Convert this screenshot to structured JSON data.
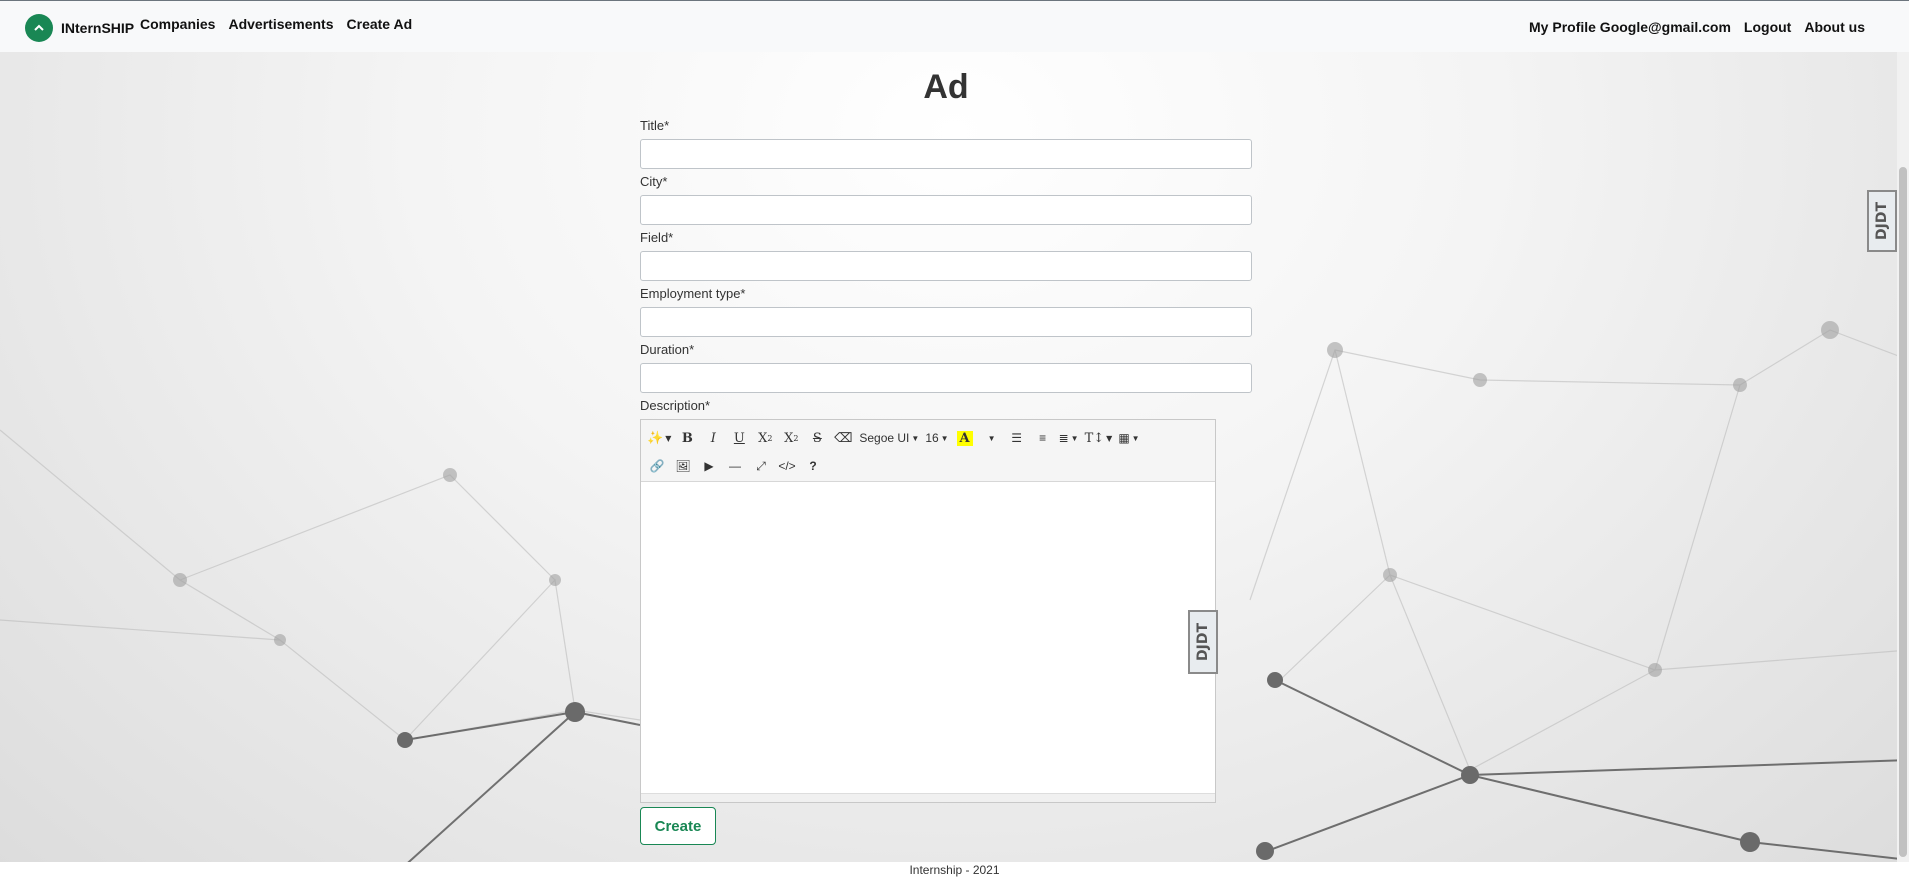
{
  "nav": {
    "brand": "INternSHIP",
    "links": [
      "Companies",
      "Advertisements",
      "Create Ad"
    ],
    "right_links": [
      "My Profile Google@gmail.com",
      "Logout",
      "About us"
    ]
  },
  "page": {
    "title": "Ad"
  },
  "form": {
    "fields": [
      {
        "label": "Title*",
        "value": ""
      },
      {
        "label": "City*",
        "value": ""
      },
      {
        "label": "Field*",
        "value": ""
      },
      {
        "label": "Employment type*",
        "value": ""
      },
      {
        "label": "Duration*",
        "value": ""
      }
    ],
    "description_label": "Description*",
    "submit_label": "Create"
  },
  "editor": {
    "font_name": "Segoe UI",
    "font_size": "16",
    "highlight_color": "#ffff00",
    "body_text": ""
  },
  "footer": {
    "text": "Internship - 2021"
  },
  "debug_toolbar": {
    "label": "DJDT"
  },
  "colors": {
    "accent": "#198754"
  }
}
